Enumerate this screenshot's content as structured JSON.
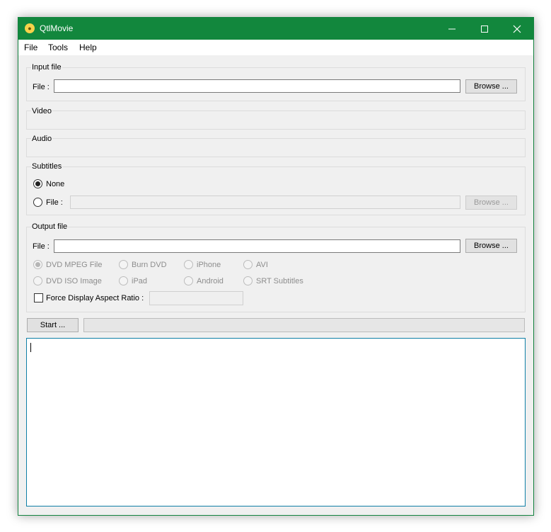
{
  "window": {
    "title": "QtlMovie",
    "icon": "app-logo-icon",
    "controls": [
      "minimize-icon",
      "maximize-icon",
      "close-icon"
    ]
  },
  "menu": [
    "File",
    "Tools",
    "Help"
  ],
  "input_group": {
    "title": "Input file",
    "file_label": "File :",
    "file_value": "",
    "browse_label": "Browse ..."
  },
  "video_group": {
    "title": "Video"
  },
  "audio_group": {
    "title": "Audio"
  },
  "subtitles_group": {
    "title": "Subtitles",
    "none_label": "None",
    "none_checked": true,
    "file_label": "File :",
    "file_checked": false,
    "file_value": "",
    "browse_label": "Browse ...",
    "browse_enabled": false
  },
  "output_group": {
    "title": "Output file",
    "file_label": "File :",
    "file_value": "",
    "browse_label": "Browse ...",
    "format_options": [
      {
        "label": "DVD MPEG File",
        "checked": true
      },
      {
        "label": "Burn DVD",
        "checked": false
      },
      {
        "label": "iPhone",
        "checked": false
      },
      {
        "label": "AVI",
        "checked": false
      },
      {
        "label": "DVD ISO Image",
        "checked": false
      },
      {
        "label": "iPad",
        "checked": false
      },
      {
        "label": "Android",
        "checked": false
      },
      {
        "label": "SRT Subtitles",
        "checked": false
      }
    ],
    "formats_enabled": false,
    "force_aspect_label": "Force Display Aspect Ratio :",
    "force_aspect_checked": false,
    "aspect_value": ""
  },
  "actions": {
    "start_label": "Start ...",
    "progress": 0
  },
  "log": {
    "text": ""
  }
}
